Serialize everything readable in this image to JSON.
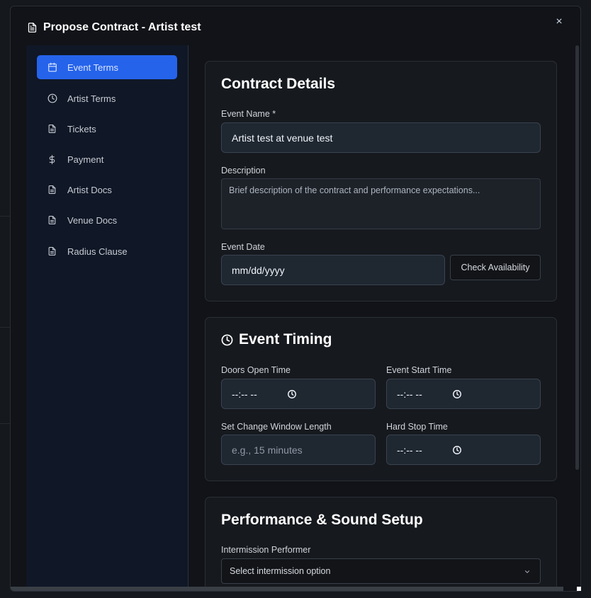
{
  "modal": {
    "title": "Propose Contract - Artist test",
    "close": "×"
  },
  "sidebar": {
    "items": [
      {
        "label": "Event Terms",
        "icon": "calendar-icon",
        "active": true
      },
      {
        "label": "Artist Terms",
        "icon": "clock-icon",
        "active": false
      },
      {
        "label": "Tickets",
        "icon": "document-icon",
        "active": false
      },
      {
        "label": "Payment",
        "icon": "dollar-icon",
        "active": false
      },
      {
        "label": "Artist Docs",
        "icon": "document-icon",
        "active": false
      },
      {
        "label": "Venue Docs",
        "icon": "document-icon",
        "active": false
      },
      {
        "label": "Radius Clause",
        "icon": "document-icon",
        "active": false
      }
    ]
  },
  "contract_details": {
    "title": "Contract Details",
    "event_name_label": "Event Name *",
    "event_name_value": "Artist test at venue test",
    "description_label": "Description",
    "description_placeholder": "Brief description of the contract and performance expectations...",
    "event_date_label": "Event Date",
    "event_date_value": "mm/dd/yyyy",
    "check_availability": "Check Availability"
  },
  "event_timing": {
    "title": "Event Timing",
    "doors_open_label": "Doors Open Time",
    "doors_open_value": "--:-- --",
    "event_start_label": "Event Start Time",
    "event_start_value": "--:-- --",
    "set_change_label": "Set Change Window Length",
    "set_change_placeholder": "e.g., 15 minutes",
    "hard_stop_label": "Hard Stop Time",
    "hard_stop_value": "--:-- --"
  },
  "performance": {
    "title": "Performance & Sound Setup",
    "intermission_label": "Intermission Performer",
    "intermission_value": "Select intermission option"
  },
  "colors": {
    "accent": "#2563eb",
    "card_bg": "#16191e",
    "sidebar_bg": "#101726"
  }
}
